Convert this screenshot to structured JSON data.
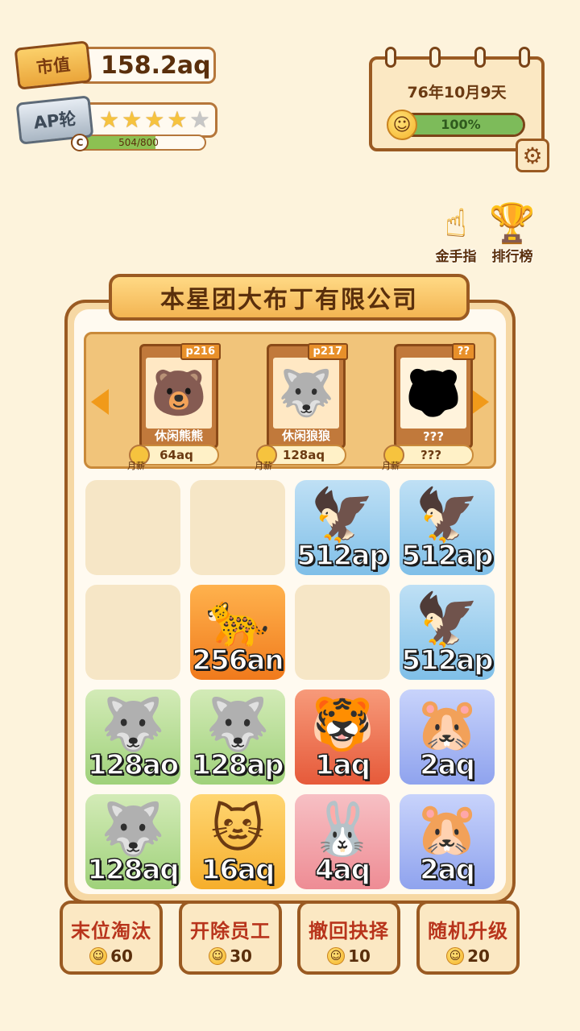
{
  "stats": {
    "market_label": "市值",
    "market_value": "158.2aq",
    "ap_label": "AP轮",
    "stars_filled": 4,
    "stars_total": 5,
    "grade": "C",
    "progress_text": "504/800",
    "progress_fraction": 0.63
  },
  "calendar": {
    "date": "76年10月9天",
    "happiness": "100%",
    "happiness_fraction": 1.0
  },
  "side_buttons": {
    "gold_finger": "金手指",
    "ranking": "排行榜"
  },
  "company": {
    "title": "本星团大布丁有限公司"
  },
  "employees": [
    {
      "tag": "p216",
      "name": "休闲熊熊",
      "icon": "bear-icon",
      "glyph": "🐻",
      "salary": "64aq",
      "period": "月薪"
    },
    {
      "tag": "p217",
      "name": "休闲狼狼",
      "icon": "wolf-icon",
      "glyph": "🐺",
      "salary": "128aq",
      "period": "月薪"
    },
    {
      "tag": "??",
      "name": "???",
      "icon": "locked-silhouette-icon",
      "glyph": "🐯",
      "salary": "???",
      "period": "月薪"
    }
  ],
  "grid": [
    {
      "empty": true
    },
    {
      "empty": true
    },
    {
      "animal": "eagle",
      "glyph": "🦅",
      "bg": "blue",
      "level": "512ap"
    },
    {
      "animal": "eagle",
      "glyph": "🦅",
      "bg": "blue",
      "level": "512ap"
    },
    {
      "empty": true
    },
    {
      "animal": "leopard",
      "glyph": "🐆",
      "bg": "orange",
      "level": "256an"
    },
    {
      "empty": true
    },
    {
      "animal": "eagle",
      "glyph": "🦅",
      "bg": "blue",
      "level": "512ap"
    },
    {
      "animal": "wolf",
      "glyph": "🐺",
      "bg": "green",
      "level": "128ao"
    },
    {
      "animal": "wolf",
      "glyph": "🐺",
      "bg": "green",
      "level": "128ap"
    },
    {
      "animal": "tiger",
      "glyph": "🐯",
      "bg": "red",
      "level": "1aq"
    },
    {
      "animal": "hamster",
      "glyph": "🐹",
      "bg": "purple",
      "level": "2aq"
    },
    {
      "animal": "wolf",
      "glyph": "🐺",
      "bg": "green",
      "level": "128aq"
    },
    {
      "animal": "cat",
      "glyph": "🐱",
      "bg": "yellow",
      "level": "16aq"
    },
    {
      "animal": "rabbit",
      "glyph": "🐰",
      "bg": "pink",
      "level": "4aq"
    },
    {
      "animal": "hamster",
      "glyph": "🐹",
      "bg": "purple",
      "level": "2aq"
    }
  ],
  "actions": [
    {
      "name": "末位淘汰",
      "cost": "60"
    },
    {
      "name": "开除员工",
      "cost": "30"
    },
    {
      "name": "撤回抉择",
      "cost": "10"
    },
    {
      "name": "随机升级",
      "cost": "20"
    }
  ]
}
